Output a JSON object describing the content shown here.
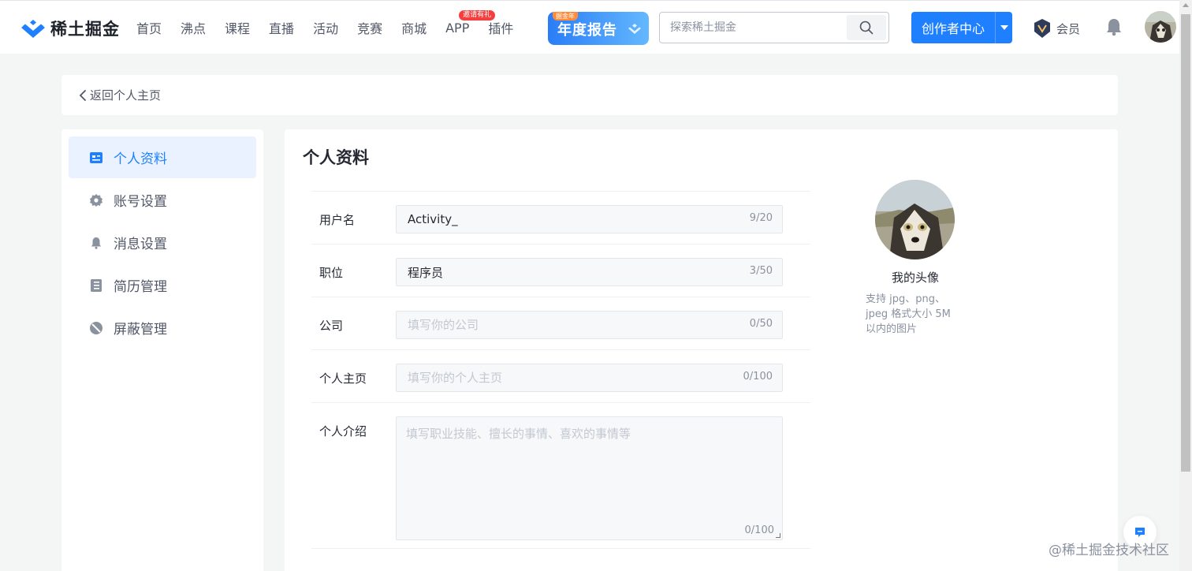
{
  "brand": {
    "name": "稀土掘金"
  },
  "nav": {
    "items": [
      {
        "label": "首页"
      },
      {
        "label": "沸点"
      },
      {
        "label": "课程"
      },
      {
        "label": "直播"
      },
      {
        "label": "活动"
      },
      {
        "label": "竞赛"
      },
      {
        "label": "商城"
      },
      {
        "label": "APP",
        "badge": "邀请有礼"
      },
      {
        "label": "插件"
      }
    ],
    "banner": {
      "text": "年度报告",
      "tag": "掘金年"
    }
  },
  "search": {
    "placeholder": "探索稀土掘金"
  },
  "creator": {
    "label": "创作者中心"
  },
  "member": {
    "label": "会员"
  },
  "back": {
    "label": "返回个人主页"
  },
  "sidebar": {
    "items": [
      {
        "label": "个人资料",
        "icon": "id-card-icon",
        "active": true
      },
      {
        "label": "账号设置",
        "icon": "gear-icon"
      },
      {
        "label": "消息设置",
        "icon": "bell-icon"
      },
      {
        "label": "简历管理",
        "icon": "resume-icon"
      },
      {
        "label": "屏蔽管理",
        "icon": "block-icon"
      }
    ]
  },
  "main": {
    "title": "个人资料",
    "fields": {
      "username": {
        "label": "用户名",
        "value": "Activity_",
        "placeholder": "",
        "counter": "9/20"
      },
      "position": {
        "label": "职位",
        "value": "程序员",
        "placeholder": "",
        "counter": "3/50"
      },
      "company": {
        "label": "公司",
        "value": "",
        "placeholder": "填写你的公司",
        "counter": "0/50"
      },
      "homepage": {
        "label": "个人主页",
        "value": "",
        "placeholder": "填写你的个人主页",
        "counter": "0/100"
      },
      "intro": {
        "label": "个人介绍",
        "value": "",
        "placeholder": "填写职业技能、擅长的事情、喜欢的事情等",
        "counter": "0/100"
      }
    },
    "avatar": {
      "label": "我的头像",
      "hint": "支持 jpg、png、jpeg 格式大小 5M 以内的图片"
    }
  },
  "watermark": "@稀土掘金技术社区",
  "colors": {
    "accent": "#1e80ff",
    "active_bg": "#eaf2ff"
  }
}
